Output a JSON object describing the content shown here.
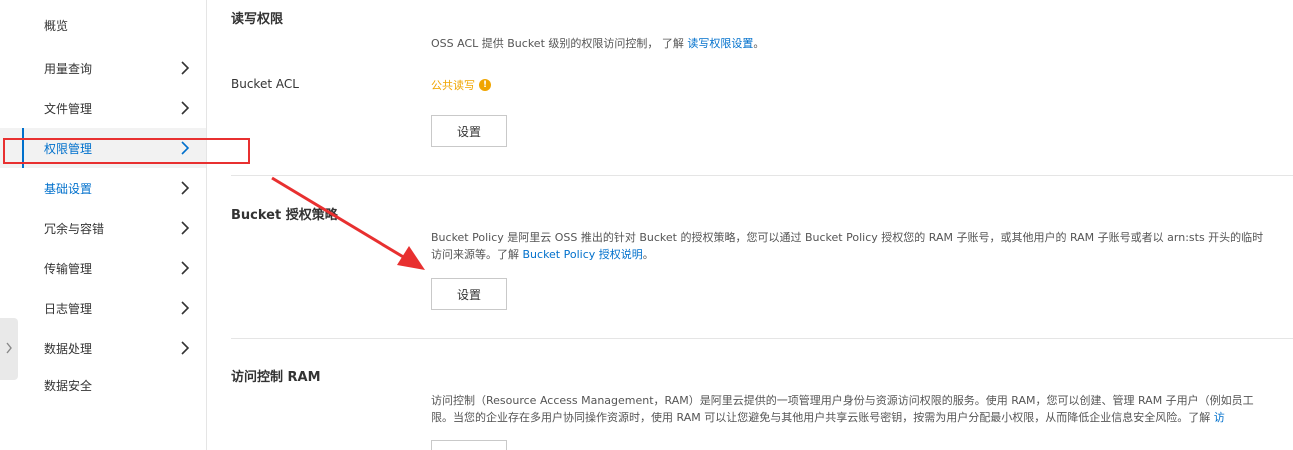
{
  "sidebar": {
    "items": [
      {
        "label": "概览",
        "has_chevron": false,
        "active": false
      },
      {
        "label": "用量查询",
        "has_chevron": true,
        "active": false
      },
      {
        "label": "文件管理",
        "has_chevron": true,
        "active": false
      },
      {
        "label": "权限管理",
        "has_chevron": true,
        "active": true
      },
      {
        "label": "基础设置",
        "has_chevron": true,
        "active": false
      },
      {
        "label": "冗余与容错",
        "has_chevron": true,
        "active": false
      },
      {
        "label": "传输管理",
        "has_chevron": true,
        "active": false
      },
      {
        "label": "日志管理",
        "has_chevron": true,
        "active": false
      },
      {
        "label": "数据处理",
        "has_chevron": true,
        "active": false
      },
      {
        "label": "数据安全",
        "has_chevron": false,
        "active": false
      }
    ]
  },
  "acl_section": {
    "title": "读写权限",
    "desc_prefix": "OSS ACL 提供 Bucket 级别的权限访问控制， 了解 ",
    "desc_link": "读写权限设置",
    "desc_suffix": "。",
    "field_label": "Bucket ACL",
    "acl_value": "公共读写",
    "button_label": "设置"
  },
  "policy_section": {
    "title": "Bucket 授权策略",
    "desc_line1": "Bucket Policy 是阿里云 OSS 推出的针对 Bucket 的授权策略，您可以通过 Bucket Policy 授权您的 RAM 子账号，或其他用户的 RAM 子账号或者以 arn:sts 开头的临时",
    "desc_line2_prefix": "访问来源等。了解 ",
    "desc_link": "Bucket Policy 授权说明",
    "desc_suffix": "。",
    "button_label": "设置"
  },
  "ram_section": {
    "title": "访问控制 RAM",
    "desc_line1": "访问控制（Resource Access Management，RAM）是阿里云提供的一项管理用户身份与资源访问权限的服务。使用 RAM，您可以创建、管理 RAM 子用户（例如员工",
    "desc_line2": "限。当您的企业存在多用户协同操作资源时，使用 RAM 可以让您避免与其他用户共享云账号密钥，按需为用户分配最小权限，从而降低企业信息安全风险。了解 ",
    "desc_link": "访"
  },
  "colors": {
    "accent": "#0070cc",
    "warning": "#f0a500",
    "annotation": "#e83030"
  }
}
